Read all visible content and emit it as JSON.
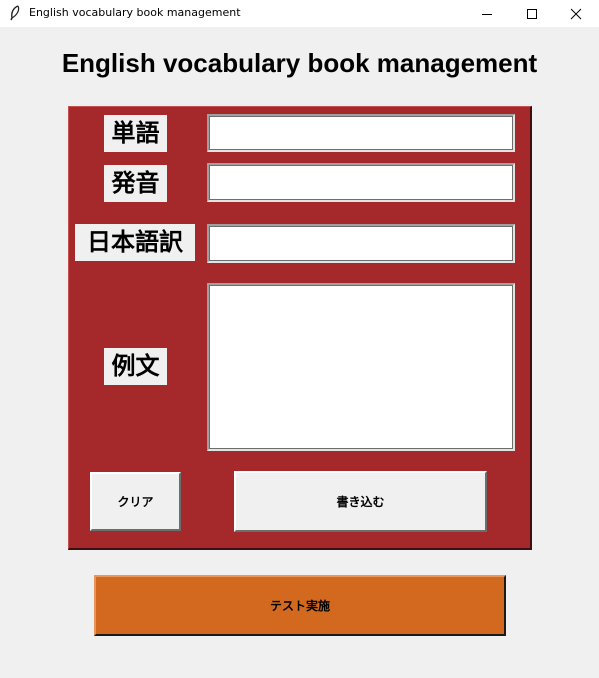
{
  "window": {
    "title": "English vocabulary book management",
    "icon": "feather-icon",
    "controls": [
      "minimize-icon",
      "maximize-icon",
      "close-icon"
    ]
  },
  "heading": "English vocabulary book management",
  "form": {
    "panel_color": "#a5292a",
    "word_label": "単語",
    "pronunciation_label": "発音",
    "translation_label": "日本語訳",
    "example_label": "例文",
    "word_value": "",
    "pronunciation_value": "",
    "translation_value": "",
    "example_value": ""
  },
  "buttons": {
    "clear_label": "クリア",
    "write_label": "書き込む",
    "test_label": "テスト実施",
    "test_color": "#d2691e"
  }
}
